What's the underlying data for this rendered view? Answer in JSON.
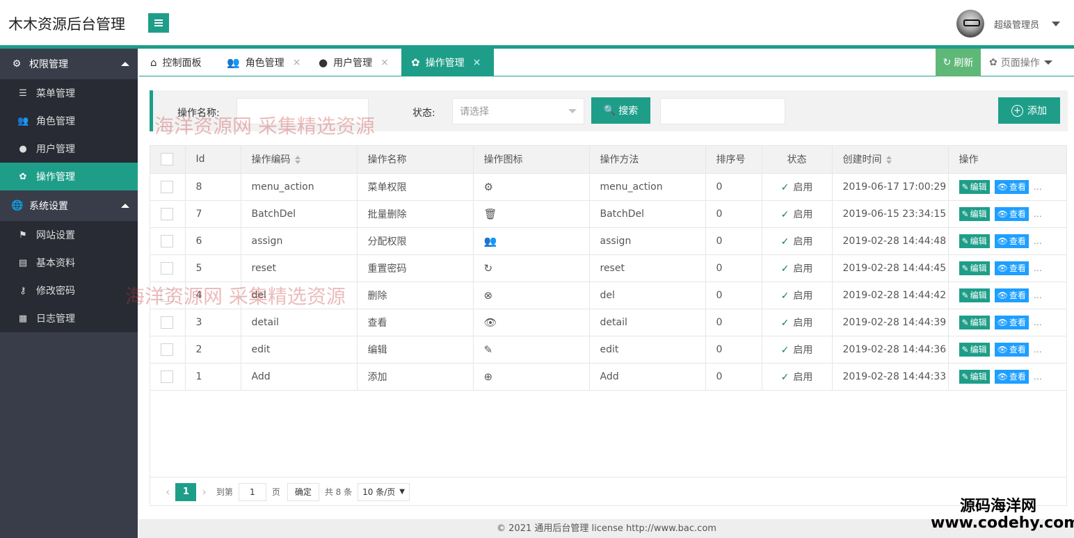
{
  "app": {
    "title": "木木资源后台管理",
    "user_name": "超级管理员"
  },
  "sidebar": {
    "groups": [
      {
        "label": "权限管理",
        "items": [
          {
            "label": "菜单管理"
          },
          {
            "label": "角色管理"
          },
          {
            "label": "用户管理"
          },
          {
            "label": "操作管理"
          }
        ]
      },
      {
        "label": "系统设置",
        "items": [
          {
            "label": "网站设置"
          },
          {
            "label": "基本资料"
          },
          {
            "label": "修改密码"
          },
          {
            "label": "日志管理"
          }
        ]
      }
    ]
  },
  "tabs": {
    "items": [
      {
        "label": "控制面板"
      },
      {
        "label": "角色管理"
      },
      {
        "label": "用户管理"
      },
      {
        "label": "操作管理"
      }
    ],
    "close_glyph": "×",
    "refresh_label": "刷新",
    "page_ops_label": "页面操作"
  },
  "search": {
    "name_label": "操作名称:",
    "name_value": "",
    "status_label": "状态:",
    "status_placeholder": "请选择",
    "search_label": "搜索",
    "add_label": "添加"
  },
  "table": {
    "headers": [
      "Id",
      "操作编码",
      "操作名称",
      "操作图标",
      "操作方法",
      "排序号",
      "状态",
      "创建时间",
      "操作"
    ],
    "edit_label": "编辑",
    "view_label": "查看",
    "more_label": "…",
    "rows": [
      {
        "id": "8",
        "code": "menu_action",
        "name": "菜单权限",
        "icon": "user-gear-icon",
        "method": "menu_action",
        "sort": "0",
        "status": "启用",
        "created": "2019-06-17 17:00:29"
      },
      {
        "id": "7",
        "code": "BatchDel",
        "name": "批量删除",
        "icon": "trash-icon",
        "method": "BatchDel",
        "sort": "0",
        "status": "启用",
        "created": "2019-06-15 23:34:15"
      },
      {
        "id": "6",
        "code": "assign",
        "name": "分配权限",
        "icon": "users-key-icon",
        "method": "assign",
        "sort": "0",
        "status": "启用",
        "created": "2019-02-28 14:44:48"
      },
      {
        "id": "5",
        "code": "reset",
        "name": "重置密码",
        "icon": "reset-icon",
        "method": "reset",
        "sort": "0",
        "status": "启用",
        "created": "2019-02-28 14:44:45"
      },
      {
        "id": "4",
        "code": "del",
        "name": "删除",
        "icon": "delete-circle-icon",
        "method": "del",
        "sort": "0",
        "status": "启用",
        "created": "2019-02-28 14:44:42"
      },
      {
        "id": "3",
        "code": "detail",
        "name": "查看",
        "icon": "eye-icon",
        "method": "detail",
        "sort": "0",
        "status": "启用",
        "created": "2019-02-28 14:44:39"
      },
      {
        "id": "2",
        "code": "edit",
        "name": "编辑",
        "icon": "edit-icon",
        "method": "edit",
        "sort": "0",
        "status": "启用",
        "created": "2019-02-28 14:44:36"
      },
      {
        "id": "1",
        "code": "Add",
        "name": "添加",
        "icon": "plus-circle-icon",
        "method": "Add",
        "sort": "0",
        "status": "启用",
        "created": "2019-02-28 14:44:33"
      }
    ]
  },
  "pager": {
    "current": "1",
    "goto_label": "到第",
    "goto_value": "1",
    "page_label": "页",
    "confirm_label": "确定",
    "total_label": "共 8 条",
    "page_size": "10 条/页"
  },
  "footer": {
    "text": "© 2021 通用后台管理 license   http://www.bac.com"
  },
  "watermark": {
    "brand": "源码海洋网",
    "url": "www.codehy.com",
    "overlay": "海洋资源网 采集精选资源"
  },
  "colors": {
    "accent": "#1e9e89",
    "sidebar": "#393d49",
    "refresh": "#5fb878",
    "view": "#1e9fff"
  }
}
